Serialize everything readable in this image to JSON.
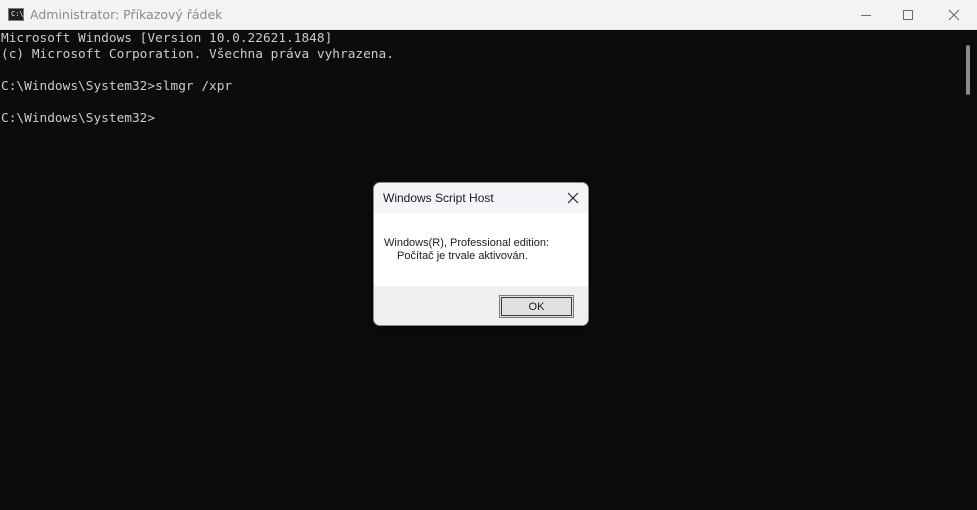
{
  "window": {
    "title": "Administrator: Příkazový řádek",
    "icon": "command-prompt-icon",
    "icon_glyph": "C:\\"
  },
  "console": {
    "lines": [
      "Microsoft Windows [Version 10.0.22621.1848]",
      "(c) Microsoft Corporation. Všechna práva vyhrazena.",
      "",
      "C:\\Windows\\System32>slmgr /xpr",
      "",
      "C:\\Windows\\System32>"
    ]
  },
  "dialog": {
    "title": "Windows Script Host",
    "message_line1": "Windows(R), Professional edition:",
    "message_line2": "Počítač je trvale aktivován.",
    "ok_label": "OK"
  },
  "colors": {
    "console_background": "#0c0c0c",
    "console_text": "#cccccc",
    "titlebar_background": "#f3f3f3",
    "dialog_footer": "#f0f0f0"
  }
}
